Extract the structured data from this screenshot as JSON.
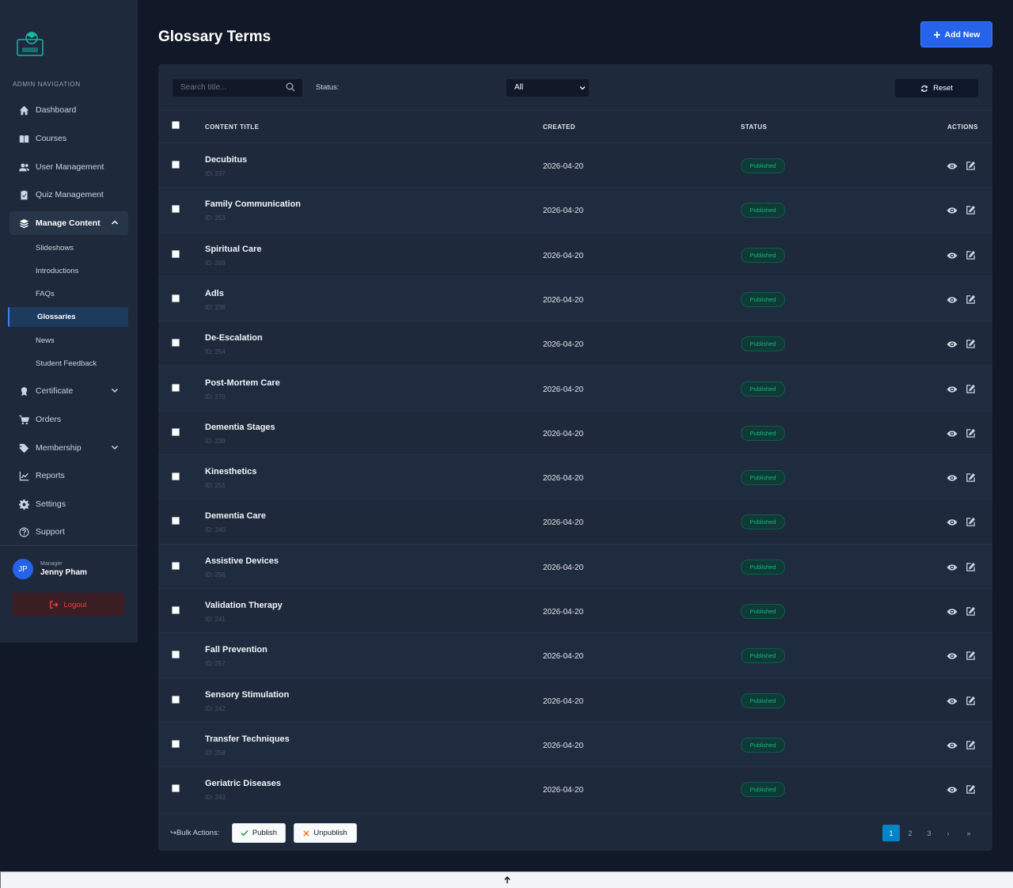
{
  "sidebar": {
    "heading": "ADMIN NAVIGATION",
    "items": [
      {
        "label": "Dashboard",
        "icon": "home-icon"
      },
      {
        "label": "Courses",
        "icon": "book-icon"
      },
      {
        "label": "User Management",
        "icon": "users-icon"
      },
      {
        "label": "Quiz Management",
        "icon": "clipboard-icon"
      },
      {
        "label": "Manage Content",
        "icon": "layers-icon"
      },
      {
        "label": "Certificate",
        "icon": "award-icon"
      },
      {
        "label": "Orders",
        "icon": "cart-icon"
      },
      {
        "label": "Membership",
        "icon": "tag-icon"
      },
      {
        "label": "Reports",
        "icon": "chart-icon"
      },
      {
        "label": "Settings",
        "icon": "gear-icon"
      },
      {
        "label": "Support",
        "icon": "question-icon"
      }
    ],
    "sub_items": [
      "Slideshows",
      "Introductions",
      "FAQs",
      "Glossaries",
      "News",
      "Student Feedback"
    ],
    "user": {
      "initials": "JP",
      "role": "Manager",
      "name": "Jenny Pham"
    },
    "logout_label": "Logout"
  },
  "header": {
    "title": "Glossary Terms",
    "add_label": "Add New"
  },
  "toolbar": {
    "search_placeholder": "Search title...",
    "status_label": "Status:",
    "status_value": "All",
    "reset_label": "Reset"
  },
  "table": {
    "columns": {
      "title": "CONTENT TITLE",
      "created": "CREATED",
      "status": "STATUS",
      "actions": "ACTIONS"
    },
    "rows": [
      {
        "title": "Decubitus",
        "id": "ID: 237",
        "created": "2026-04-20",
        "status": "Published"
      },
      {
        "title": "Family Communication",
        "id": "ID: 253",
        "created": "2026-04-20",
        "status": "Published"
      },
      {
        "title": "Spiritual Care",
        "id": "ID: 269",
        "created": "2026-04-20",
        "status": "Published"
      },
      {
        "title": "Adls",
        "id": "ID: 238",
        "created": "2026-04-20",
        "status": "Published"
      },
      {
        "title": "De-Escalation",
        "id": "ID: 254",
        "created": "2026-04-20",
        "status": "Published"
      },
      {
        "title": "Post-Mortem Care",
        "id": "ID: 270",
        "created": "2026-04-20",
        "status": "Published"
      },
      {
        "title": "Dementia Stages",
        "id": "ID: 239",
        "created": "2026-04-20",
        "status": "Published"
      },
      {
        "title": "Kinesthetics",
        "id": "ID: 255",
        "created": "2026-04-20",
        "status": "Published"
      },
      {
        "title": "Dementia Care",
        "id": "ID: 240",
        "created": "2026-04-20",
        "status": "Published"
      },
      {
        "title": "Assistive Devices",
        "id": "ID: 256",
        "created": "2026-04-20",
        "status": "Published"
      },
      {
        "title": "Validation Therapy",
        "id": "ID: 241",
        "created": "2026-04-20",
        "status": "Published"
      },
      {
        "title": "Fall Prevention",
        "id": "ID: 257",
        "created": "2026-04-20",
        "status": "Published"
      },
      {
        "title": "Sensory Stimulation",
        "id": "ID: 242",
        "created": "2026-04-20",
        "status": "Published"
      },
      {
        "title": "Transfer Techniques",
        "id": "ID: 258",
        "created": "2026-04-20",
        "status": "Published"
      },
      {
        "title": "Geriatric Diseases",
        "id": "ID: 243",
        "created": "2026-04-20",
        "status": "Published"
      }
    ]
  },
  "footer": {
    "bulk_label": "Bulk Actions:",
    "publish_label": "Publish",
    "unpublish_label": "Unpublish",
    "pages": [
      "1",
      "2",
      "3",
      "›",
      "»"
    ],
    "current_page": "1"
  },
  "colors": {
    "accent": "#2563eb",
    "published": "#10b981",
    "danger": "#ef4444"
  }
}
